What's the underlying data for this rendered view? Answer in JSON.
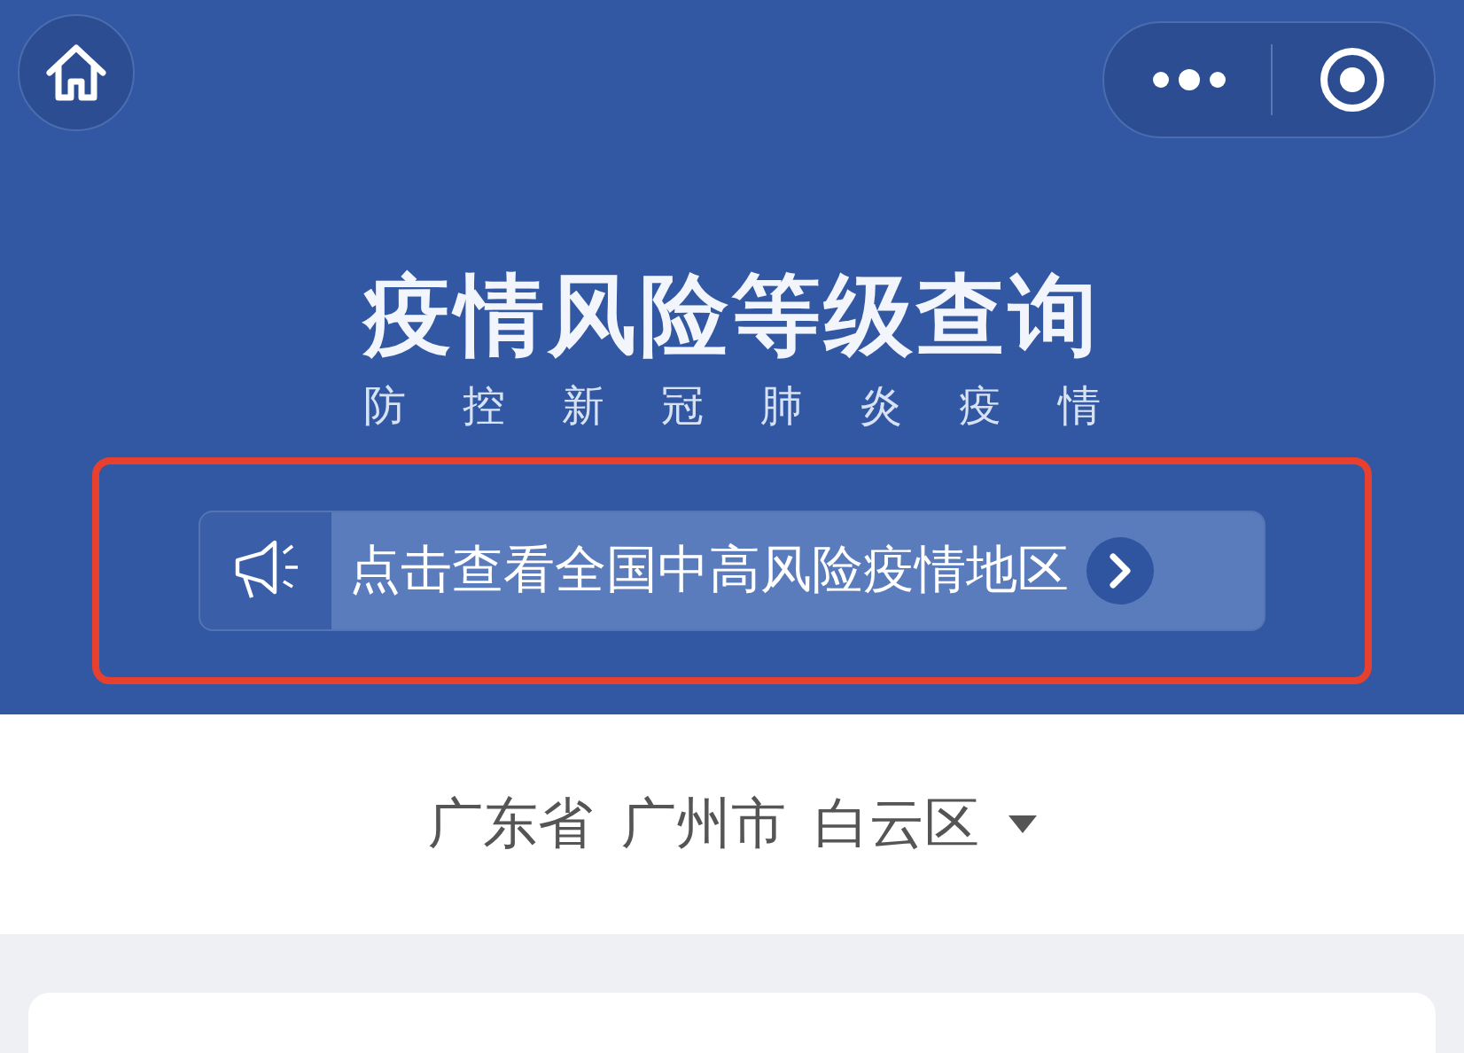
{
  "header": {
    "title": "疫情风险等级查询",
    "subtitle": "防控新冠肺炎疫情"
  },
  "banner": {
    "text": "点击查看全国中高风险疫情地区",
    "highlighted": true
  },
  "location": [
    "广东省",
    "广州市",
    "白云区"
  ]
}
